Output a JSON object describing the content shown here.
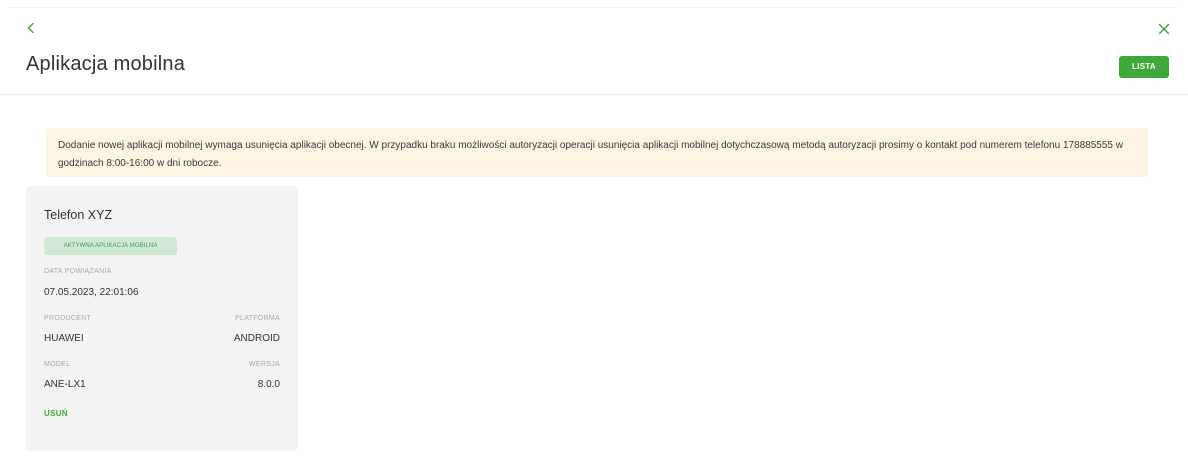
{
  "header": {
    "title": "Aplikacja mobilna",
    "list_button_label": "LISTA"
  },
  "notice": {
    "text": "Dodanie nowej aplikacji mobilnej wymaga usunięcia aplikacji obecnej. W przypadku braku możliwości autoryzacji operacji usunięcia aplikacji mobilnej dotychczasową metodą autoryzacji prosimy o kontakt pod numerem telefonu 178885555 w godzinach 8:00-16:00 w dni robocze."
  },
  "device": {
    "name": "Telefon XYZ",
    "status": "AKTYWNA APLIKACJA MOBILNA",
    "link_date_label": "DATA POWIĄZANIA",
    "link_date": "07.05.2023, 22:01:06",
    "producer_label": "PRODUCENT",
    "producer": "HUAWEI",
    "platform_label": "PLATFORMA",
    "platform": "ANDROID",
    "model_label": "MODEL",
    "model": "ANE-LX1",
    "version_label": "WERSJA",
    "version": "8.0.0",
    "delete_label": "USUŃ"
  },
  "icons": {
    "back": "chevron-left-icon",
    "close": "close-icon"
  },
  "colors": {
    "accent": "#3da93a",
    "notice_bg": "#fdf3e3",
    "card_bg": "#f3f3f3",
    "badge_bg": "#cfe9d5",
    "badge_text": "#3b9a5a"
  }
}
